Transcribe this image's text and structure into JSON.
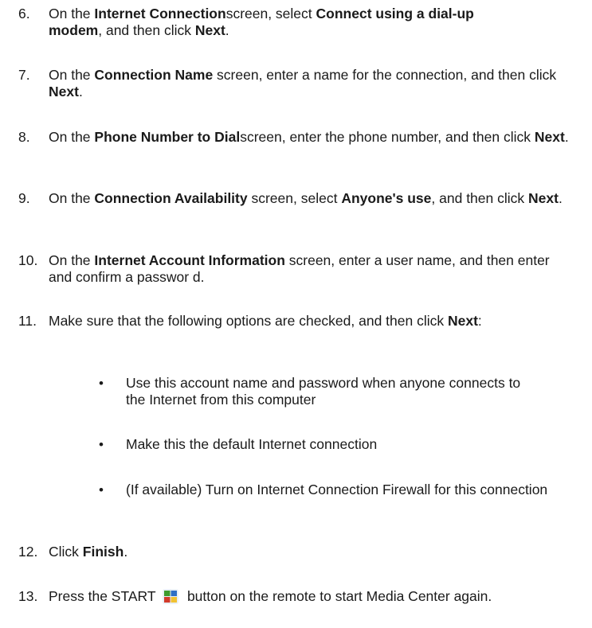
{
  "steps": [
    {
      "num": "6.",
      "parts": [
        {
          "t": "On the "
        },
        {
          "t": "Internet Connection",
          "b": true
        },
        {
          "t": "screen, select "
        },
        {
          "t": "Connect using a dial-up modem",
          "b": true
        },
        {
          "t": ", and then click "
        },
        {
          "t": "Next",
          "b": true
        },
        {
          "t": "."
        }
      ]
    },
    {
      "num": "7.",
      "parts": [
        {
          "t": "On the "
        },
        {
          "t": "Connection Name",
          "b": true
        },
        {
          "t": " screen, enter a name for the connection, and then click "
        },
        {
          "t": "Next",
          "b": true
        },
        {
          "t": "."
        }
      ]
    },
    {
      "num": "8.",
      "parts": [
        {
          "t": "On the "
        },
        {
          "t": "Phone Number to Dial",
          "b": true
        },
        {
          "t": "screen, enter the phone number, and then click "
        },
        {
          "t": "Next",
          "b": true
        },
        {
          "t": "."
        }
      ]
    },
    {
      "num": "9.",
      "parts": [
        {
          "t": "On the "
        },
        {
          "t": "Connection Availability",
          "b": true
        },
        {
          "t": " screen, select "
        },
        {
          "t": "Anyone's use",
          "b": true
        },
        {
          "t": ", and then click "
        },
        {
          "t": "Next",
          "b": true
        },
        {
          "t": "."
        }
      ]
    },
    {
      "num": "10.",
      "parts": [
        {
          "t": "On the "
        },
        {
          "t": "Internet Account Information",
          "b": true
        },
        {
          "t": " screen, enter a user name, and then enter and confirm a passwor d."
        }
      ]
    },
    {
      "num": "11.",
      "parts": [
        {
          "t": "Make sure that the following options are checked, and then click "
        },
        {
          "t": "Next",
          "b": true
        },
        {
          "t": ":"
        }
      ]
    },
    {
      "num": "12.",
      "parts": [
        {
          "t": "Click "
        },
        {
          "t": "Finish",
          "b": true
        },
        {
          "t": "."
        }
      ]
    },
    {
      "num": "13.",
      "parts": [
        {
          "t": "Press the START "
        },
        {
          "icon": "media-center-start-icon"
        },
        {
          "t": " button on the remote to start Media Center again."
        }
      ]
    }
  ],
  "bullets": [
    "Use this account name and password when anyone connects to the Internet from this computer",
    "Make this the default Internet connection",
    "(If available) Turn on Internet Connection Firewall for this connection"
  ],
  "bullet_glyph": "•",
  "icon_colors": {
    "green": "#3f9b2e",
    "blue": "#2f6fc4",
    "yellow": "#f1c232",
    "red": "#d23b2a"
  }
}
